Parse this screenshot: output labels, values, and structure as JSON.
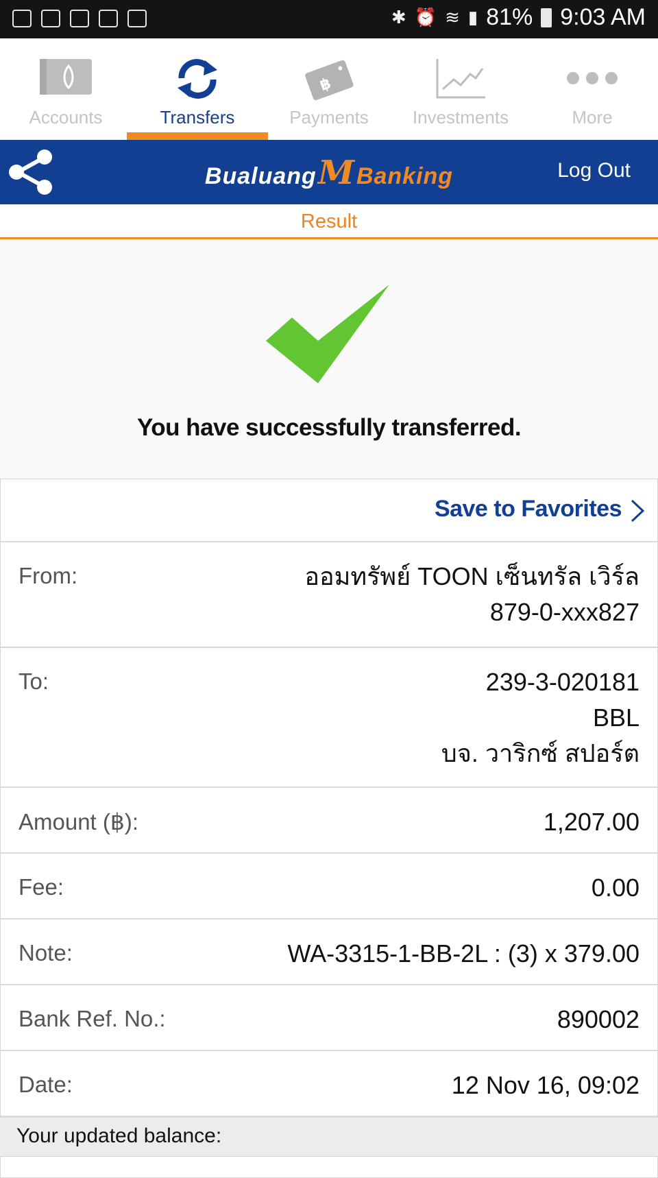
{
  "status_bar": {
    "battery": "81%",
    "time": "9:03 AM",
    "left_icons": [
      "email-icon",
      "mail-icon",
      "outlook-icon",
      "at-icon",
      "gallery-icon"
    ]
  },
  "tabs": [
    {
      "label": "Accounts",
      "icon": "wallet-icon",
      "active": false
    },
    {
      "label": "Transfers",
      "icon": "transfer-icon",
      "active": true
    },
    {
      "label": "Payments",
      "icon": "card-icon",
      "active": false
    },
    {
      "label": "Investments",
      "icon": "chart-icon",
      "active": false
    },
    {
      "label": "More",
      "icon": "more-dots-icon",
      "active": false
    }
  ],
  "header": {
    "brand_left": "Bualuang",
    "brand_m": "M",
    "brand_right": "Banking",
    "logout": "Log Out"
  },
  "result": {
    "title": "Result",
    "message": "You have successfully transferred."
  },
  "details": {
    "save_favorites": "Save to Favorites",
    "from": {
      "label": "From:",
      "lines": [
        "ออมทรัพย์ TOON เซ็นทรัล เวิร์ล",
        "879-0-xxx827"
      ]
    },
    "to": {
      "label": "To:",
      "lines": [
        "239-3-020181",
        "BBL",
        "บจ. วาริกซ์ สปอร์ต"
      ]
    },
    "amount": {
      "label": "Amount (฿):",
      "value": "1,207.00"
    },
    "fee": {
      "label": "Fee:",
      "value": "0.00"
    },
    "note": {
      "label": "Note:",
      "value": "WA-3315-1-BB-2L : (3) x 379.00"
    },
    "ref": {
      "label": "Bank Ref. No.:",
      "value": "890002"
    },
    "date": {
      "label": "Date:",
      "value": "12 Nov 16, 09:02"
    }
  },
  "balance": {
    "label": "Your updated balance:"
  },
  "colors": {
    "brand_blue": "#123f92",
    "accent_orange": "#f08a24",
    "success_green": "#62c632"
  }
}
